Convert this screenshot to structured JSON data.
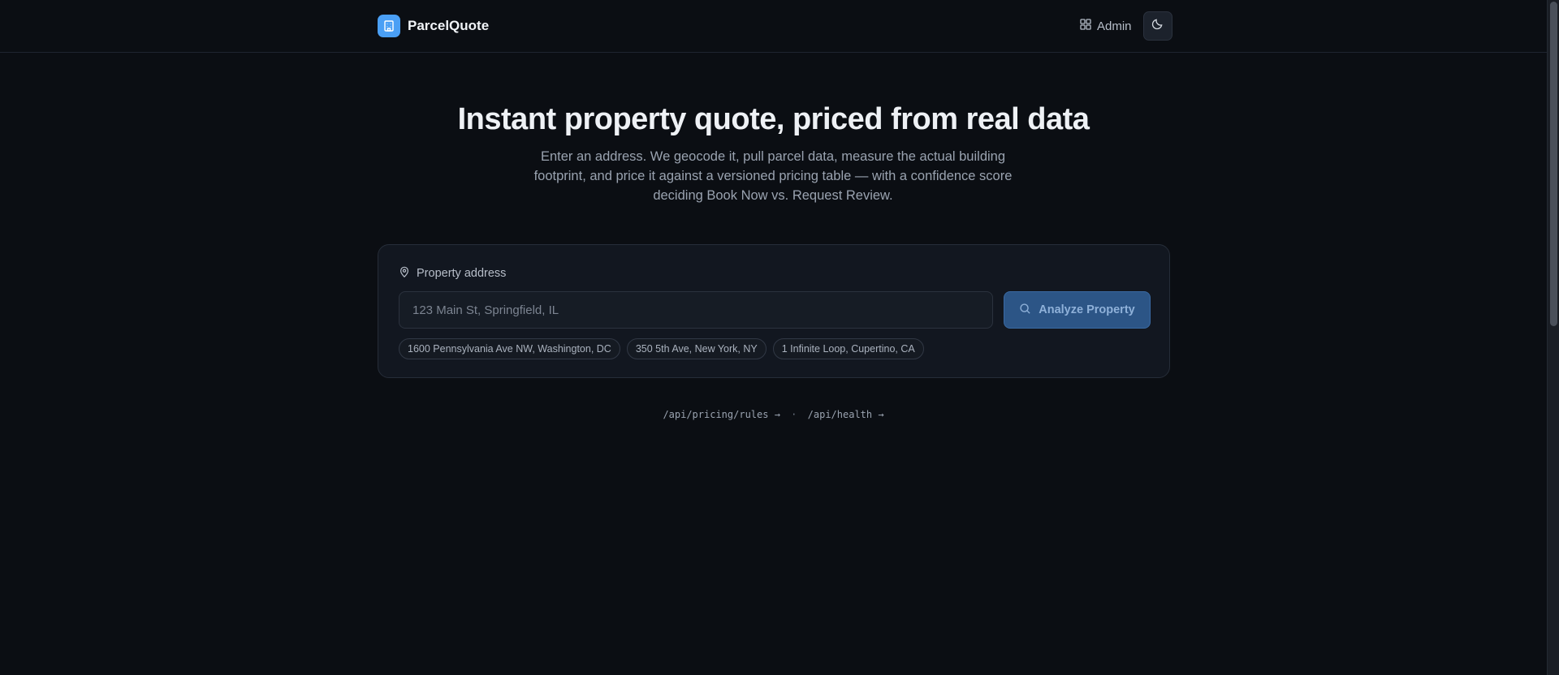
{
  "header": {
    "brand": "ParcelQuote",
    "admin_label": "Admin"
  },
  "hero": {
    "title": "Instant property quote, priced from real data",
    "subtitle": "Enter an address. We geocode it, pull parcel data, measure the actual building footprint, and price it against a versioned pricing table — with a confidence score deciding Book Now vs. Request Review."
  },
  "form": {
    "label": "Property address",
    "input_value": "",
    "placeholder": "123 Main St, Springfield, IL",
    "button_label": "Analyze Property",
    "suggestions": [
      "1600 Pennsylvania Ave NW, Washington, DC",
      "350 5th Ave, New York, NY",
      "1 Infinite Loop, Cupertino, CA"
    ]
  },
  "links": {
    "pricing_rules": "/api/pricing/rules →",
    "separator": "·",
    "health": "/api/health →"
  },
  "colors": {
    "background": "#0b0e13",
    "accent": "#4a9ff5",
    "button": "#2c5586"
  },
  "icons": {
    "logo": "building-icon",
    "admin": "grid-icon",
    "theme": "moon-icon",
    "label": "map-pin-icon",
    "button": "search-icon"
  }
}
